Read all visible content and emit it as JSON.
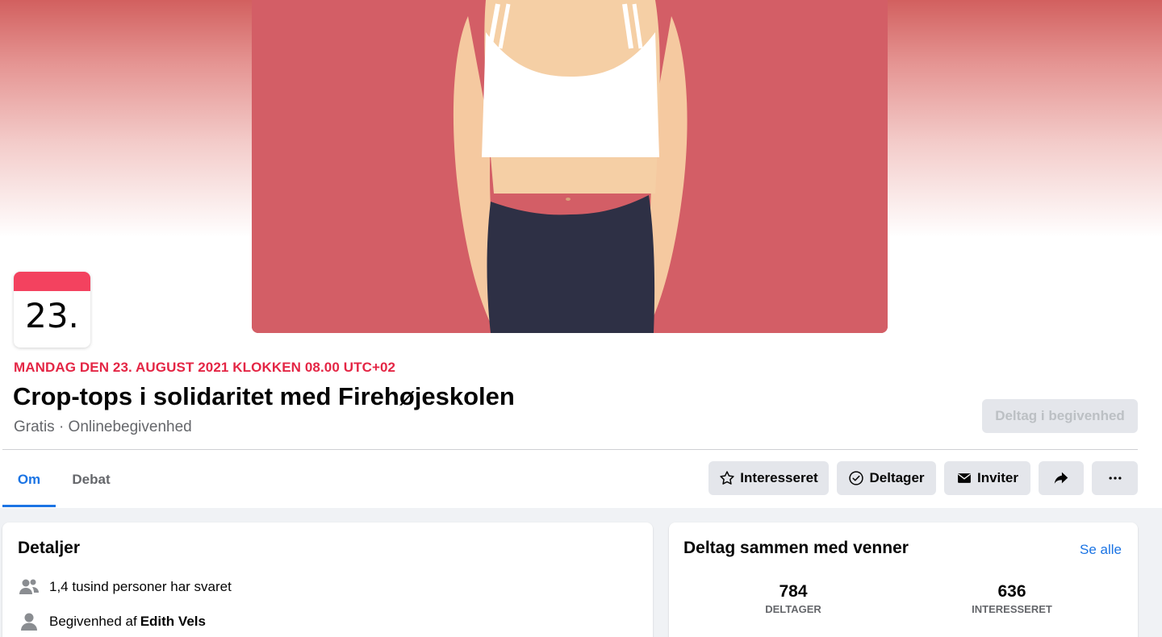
{
  "event": {
    "badge_day": "23.",
    "date_line": "MANDAG DEN 23. AUGUST 2021 KLOKKEN 08.00 UTC+02",
    "title": "Crop-tops i solidaritet med Firehøjeskolen",
    "subtitle": "Gratis · Onlinebegivenhed",
    "join_label": "Deltag i begivenhed"
  },
  "tabs": [
    {
      "label": "Om"
    },
    {
      "label": "Debat"
    }
  ],
  "actions": {
    "interested": "Interesseret",
    "going": "Deltager",
    "invite": "Inviter"
  },
  "details": {
    "title": "Detaljer",
    "responses": "1,4 tusind personer har svaret",
    "host_prefix": "Begivenhed af",
    "host_name": "Edith Vels"
  },
  "friends": {
    "title": "Deltag sammen med venner",
    "see_all": "Se alle",
    "going_count": "784",
    "going_label": "DELTAGER",
    "interested_count": "636",
    "interested_label": "INTERESSERET"
  },
  "colors": {
    "accent": "#1b74e4",
    "date_red": "#e42645",
    "cover": "#d35e66"
  },
  "icons": [
    "star-icon",
    "check-circle-icon",
    "envelope-icon",
    "share-arrow-icon",
    "more-icon",
    "people-icon",
    "person-icon"
  ]
}
